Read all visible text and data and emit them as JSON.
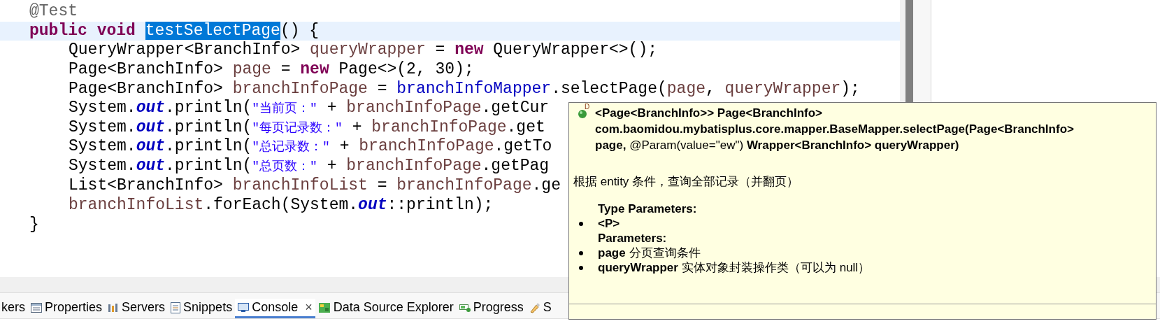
{
  "editor": {
    "lines": [
      {
        "highlighted": false,
        "tokens": [
          {
            "kind": "annotation",
            "text": "@Test"
          }
        ]
      },
      {
        "highlighted": true,
        "tokens": [
          {
            "kind": "keyword",
            "text": "public "
          },
          {
            "kind": "keyword",
            "text": "void "
          },
          {
            "kind": "selected",
            "text": "testSelectPage"
          },
          {
            "kind": "plain",
            "text": "() {"
          }
        ],
        "children": [
          {
            "highlighted": false,
            "tokens": [
              {
                "kind": "plain",
                "text": "QueryWrapper<BranchInfo> "
              },
              {
                "kind": "local",
                "text": "queryWrapper"
              },
              {
                "kind": "plain",
                "text": " = "
              },
              {
                "kind": "keyword",
                "text": "new"
              },
              {
                "kind": "plain",
                "text": " QueryWrapper<>();"
              }
            ]
          },
          {
            "highlighted": false,
            "tokens": [
              {
                "kind": "plain",
                "text": "Page<BranchInfo> "
              },
              {
                "kind": "local",
                "text": "page"
              },
              {
                "kind": "plain",
                "text": " = "
              },
              {
                "kind": "keyword",
                "text": "new"
              },
              {
                "kind": "plain",
                "text": " Page<>(2, 30);"
              }
            ]
          },
          {
            "highlighted": false,
            "tokens": [
              {
                "kind": "plain",
                "text": "Page<BranchInfo> "
              },
              {
                "kind": "local",
                "text": "branchInfoPage"
              },
              {
                "kind": "plain",
                "text": " = "
              },
              {
                "kind": "field",
                "text": "branchInfoMapper"
              },
              {
                "kind": "plain",
                "text": ".selectPage("
              },
              {
                "kind": "local",
                "text": "page"
              },
              {
                "kind": "plain",
                "text": ", "
              },
              {
                "kind": "local",
                "text": "queryWrapper"
              },
              {
                "kind": "plain",
                "text": ");"
              }
            ]
          },
          {
            "highlighted": false,
            "tokens": [
              {
                "kind": "plain",
                "text": "System."
              },
              {
                "kind": "static",
                "text": "out"
              },
              {
                "kind": "plain",
                "text": ".println("
              },
              {
                "kind": "string",
                "text": "\"当前页：\""
              },
              {
                "kind": "plain",
                "text": " + "
              },
              {
                "kind": "local",
                "text": "branchInfoPage"
              },
              {
                "kind": "plain",
                "text": ".getCur"
              }
            ]
          },
          {
            "highlighted": false,
            "tokens": [
              {
                "kind": "plain",
                "text": "System."
              },
              {
                "kind": "static",
                "text": "out"
              },
              {
                "kind": "plain",
                "text": ".println("
              },
              {
                "kind": "string",
                "text": "\"每页记录数：\""
              },
              {
                "kind": "plain",
                "text": " + "
              },
              {
                "kind": "local",
                "text": "branchInfoPage"
              },
              {
                "kind": "plain",
                "text": ".get"
              }
            ]
          },
          {
            "highlighted": false,
            "tokens": [
              {
                "kind": "plain",
                "text": "System."
              },
              {
                "kind": "static",
                "text": "out"
              },
              {
                "kind": "plain",
                "text": ".println("
              },
              {
                "kind": "string",
                "text": "\"总记录数：\""
              },
              {
                "kind": "plain",
                "text": " + "
              },
              {
                "kind": "local",
                "text": "branchInfoPage"
              },
              {
                "kind": "plain",
                "text": ".getTo"
              }
            ]
          },
          {
            "highlighted": false,
            "tokens": [
              {
                "kind": "plain",
                "text": "System."
              },
              {
                "kind": "static",
                "text": "out"
              },
              {
                "kind": "plain",
                "text": ".println("
              },
              {
                "kind": "string",
                "text": "\"总页数：\""
              },
              {
                "kind": "plain",
                "text": " + "
              },
              {
                "kind": "local",
                "text": "branchInfoPage"
              },
              {
                "kind": "plain",
                "text": ".getPag"
              }
            ]
          },
          {
            "highlighted": false,
            "tokens": [
              {
                "kind": "plain",
                "text": "List<BranchInfo> "
              },
              {
                "kind": "local",
                "text": "branchInfoList"
              },
              {
                "kind": "plain",
                "text": " = "
              },
              {
                "kind": "local",
                "text": "branchInfoPage"
              },
              {
                "kind": "plain",
                "text": ".ge"
              }
            ]
          },
          {
            "highlighted": false,
            "tokens": [
              {
                "kind": "local",
                "text": "branchInfoList"
              },
              {
                "kind": "plain",
                "text": ".forEach(System."
              },
              {
                "kind": "static",
                "text": "out"
              },
              {
                "kind": "plain",
                "text": "::println);"
              }
            ]
          }
        ]
      },
      {
        "highlighted": false,
        "tokens": [
          {
            "kind": "plain",
            "text": "}"
          }
        ]
      }
    ]
  },
  "tooltip": {
    "icon_badge": "D",
    "signature_lines": [
      "**<Page<BranchInfo>> Page<BranchInfo>**",
      "**com.baomidou.mybatisplus.core.mapper.BaseMapper.selectPage(Page<BranchInfo>**",
      "**page,** @Param(value=\"ew\") **Wrapper<BranchInfo> queryWrapper)**"
    ],
    "description": "根据 entity 条件，查询全部记录（并翻页）",
    "type_parameters_heading": "Type Parameters:",
    "type_parameters": [
      "<P>"
    ],
    "parameters_heading": "Parameters:",
    "parameters": [
      {
        "name": "page",
        "description": "分页查询条件"
      },
      {
        "name": "queryWrapper",
        "description": "实体对象封装操作类（可以为 null）"
      }
    ]
  },
  "bottom_tabs": [
    {
      "label": "kers",
      "selected": false
    },
    {
      "label": "Properties",
      "selected": false
    },
    {
      "label": "Servers",
      "selected": false
    },
    {
      "label": "Snippets",
      "selected": false
    },
    {
      "label": "Console",
      "selected": true,
      "close": "×"
    },
    {
      "label": "Data Source Explorer",
      "selected": false
    },
    {
      "label": "Progress",
      "selected": false
    },
    {
      "label": "S",
      "selected": false
    }
  ]
}
